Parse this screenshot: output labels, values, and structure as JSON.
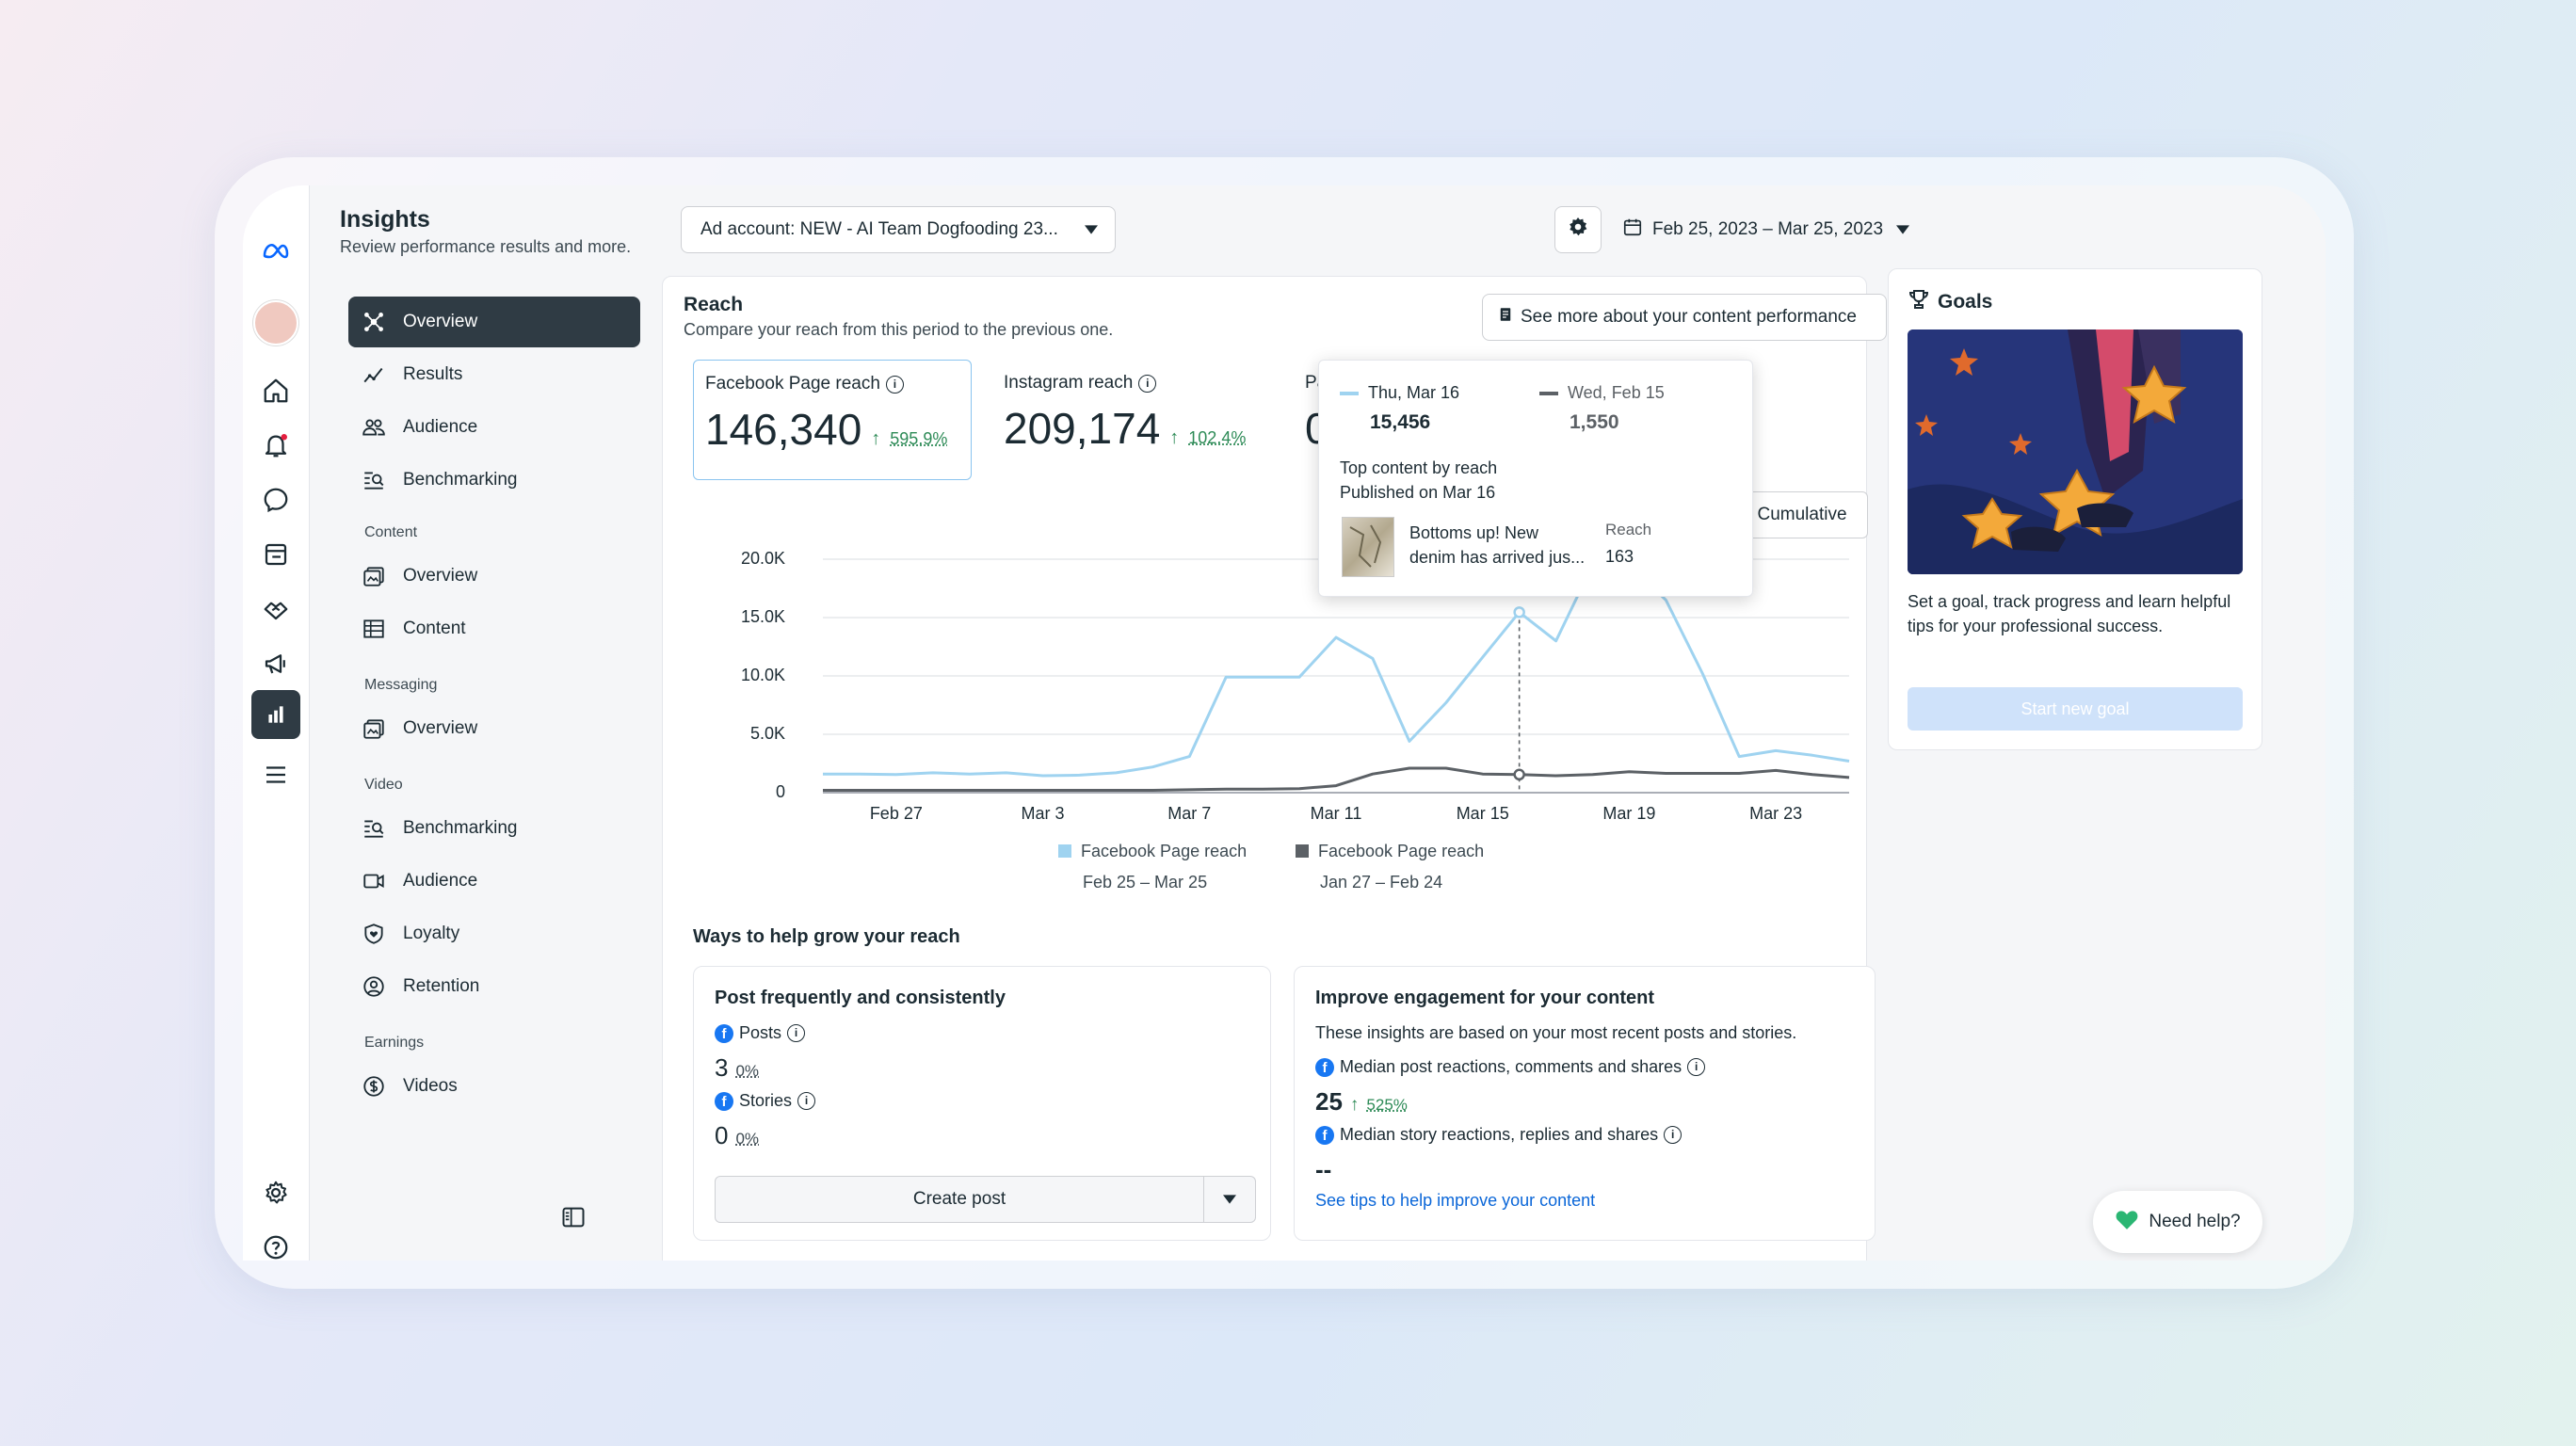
{
  "header": {
    "title": "Insights",
    "subtitle": "Review performance results and more.",
    "ad_account": "Ad account: NEW - AI Team Dogfooding 23...",
    "date_range": "Feb 25, 2023 – Mar 25, 2023"
  },
  "nav": {
    "items": [
      {
        "label": "Overview",
        "icon": "overview-icon"
      },
      {
        "label": "Results",
        "icon": "results-icon"
      },
      {
        "label": "Audience",
        "icon": "audience-icon"
      },
      {
        "label": "Benchmarking",
        "icon": "benchmarking-icon"
      }
    ],
    "content_section": "Content",
    "content_items": [
      {
        "label": "Overview",
        "icon": "content-overview-icon"
      },
      {
        "label": "Content",
        "icon": "table-icon"
      }
    ],
    "messaging_section": "Messaging",
    "messaging_items": [
      {
        "label": "Overview",
        "icon": "messaging-overview-icon"
      }
    ],
    "video_section": "Video",
    "video_items": [
      {
        "label": "Benchmarking",
        "icon": "benchmarking-icon"
      },
      {
        "label": "Audience",
        "icon": "video-icon"
      },
      {
        "label": "Loyalty",
        "icon": "loyalty-icon"
      },
      {
        "label": "Retention",
        "icon": "retention-icon"
      }
    ],
    "earnings_section": "Earnings",
    "earnings_items": [
      {
        "label": "Videos",
        "icon": "dollar-icon"
      }
    ]
  },
  "reach": {
    "title": "Reach",
    "subtitle": "Compare your reach from this period to the previous one.",
    "see_more": "See more about your content performance",
    "cumulative": "Cumulative",
    "metrics": [
      {
        "label": "Facebook Page reach",
        "value": "146,340",
        "delta": "595.9%"
      },
      {
        "label": "Instagram reach",
        "value": "209,174",
        "delta": "102.4%"
      },
      {
        "label": "Pa",
        "value": "0"
      }
    ],
    "legend": [
      {
        "name": "Facebook Page reach",
        "range": "Feb 25 – Mar 25",
        "color": "#9fd3f0"
      },
      {
        "name": "Facebook Page reach",
        "range": "Jan 27 – Feb 24",
        "color": "#5c6166"
      }
    ]
  },
  "tooltip": {
    "current_date": "Thu, Mar 16",
    "current_value": "15,456",
    "previous_date": "Wed, Feb 15",
    "previous_value": "1,550",
    "top_content_title": "Top content by reach",
    "published": "Published on Mar 16",
    "post_text_1": "Bottoms up! New",
    "post_text_2": "denim has arrived jus...",
    "reach_label": "Reach",
    "reach_value": "163"
  },
  "chart_data": {
    "type": "line",
    "x": [
      "Feb 25",
      "Feb 26",
      "Feb 27",
      "Feb 28",
      "Mar 1",
      "Mar 2",
      "Mar 3",
      "Mar 4",
      "Mar 5",
      "Mar 6",
      "Mar 7",
      "Mar 8",
      "Mar 9",
      "Mar 10",
      "Mar 11",
      "Mar 12",
      "Mar 13",
      "Mar 14",
      "Mar 15",
      "Mar 16",
      "Mar 17",
      "Mar 18",
      "Mar 19",
      "Mar 20",
      "Mar 21",
      "Mar 22",
      "Mar 23",
      "Mar 24",
      "Mar 25"
    ],
    "x_tick_labels": [
      "Feb 27",
      "Mar 3",
      "Mar 7",
      "Mar 11",
      "Mar 15",
      "Mar 19",
      "Mar 23"
    ],
    "y_tick_labels": [
      "0",
      "5.0K",
      "10.0K",
      "15.0K",
      "20.0K"
    ],
    "ylim": [
      0,
      20000
    ],
    "series": [
      {
        "name": "Facebook Page reach",
        "color": "#9fd3f0",
        "values": [
          1600,
          1600,
          1550,
          1700,
          1600,
          1700,
          1450,
          1500,
          1700,
          2200,
          3100,
          9900,
          9900,
          9900,
          13300,
          11500,
          4400,
          7700,
          11600,
          15456,
          13000,
          19500,
          19500,
          16500,
          10200,
          3100,
          3600,
          3200,
          2700
        ]
      },
      {
        "name": "Facebook Page reach",
        "color": "#5c6166",
        "values": [
          200,
          200,
          200,
          200,
          200,
          200,
          200,
          200,
          200,
          200,
          250,
          300,
          300,
          350,
          600,
          1600,
          2100,
          2100,
          1600,
          1550,
          1450,
          1550,
          1800,
          1650,
          1650,
          1650,
          1900,
          1550,
          1300
        ]
      }
    ],
    "grid": true
  },
  "grow": {
    "title": "Ways to help grow your reach",
    "card1": {
      "title": "Post frequently and consistently",
      "posts_label": "Posts",
      "posts_value": "3",
      "posts_delta": "0%",
      "stories_label": "Stories",
      "stories_value": "0",
      "stories_delta": "0%",
      "create_post": "Create post"
    },
    "card2": {
      "title": "Improve engagement for your content",
      "desc": "These insights are based on your most recent posts and stories.",
      "m1_label": "Median post reactions, comments and shares",
      "m1_value": "25",
      "m1_delta": "525%",
      "m2_label": "Median story reactions, replies and shares",
      "m2_value": "--",
      "link": "See tips to help improve your content"
    }
  },
  "goals": {
    "title": "Goals",
    "desc": "Set a goal, track progress and learn helpful tips for your professional success.",
    "button": "Start new goal"
  },
  "help": {
    "label": "Need help?"
  }
}
